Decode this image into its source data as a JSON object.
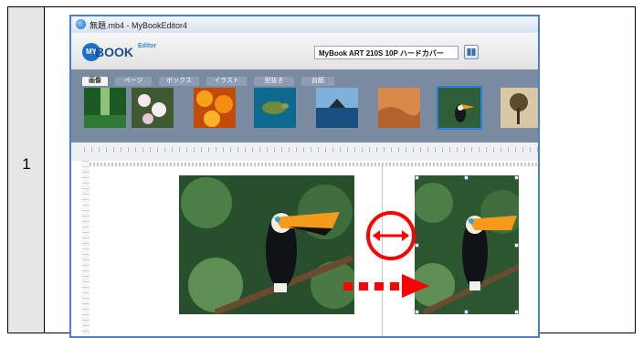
{
  "step": {
    "number": "1"
  },
  "window": {
    "title": "無題.mb4 - MyBookEditor4"
  },
  "toolbar": {
    "logo_badge": "MY",
    "logo_text": "BOOK",
    "logo_sub": "Editor",
    "product_select_value": "MyBook ART 210S 10P ハードカバー"
  },
  "tabs": [
    {
      "label": "画像",
      "active": true
    },
    {
      "label": "ページ",
      "active": false
    },
    {
      "label": "ボックス",
      "active": false
    },
    {
      "label": "イラスト",
      "active": false
    },
    {
      "label": "型抜き",
      "active": false
    },
    {
      "label": "台紙",
      "active": false
    }
  ],
  "thumbnails": [
    {
      "name": "forest-path-thumbnail",
      "selected": false
    },
    {
      "name": "white-flowers-thumbnail",
      "selected": false
    },
    {
      "name": "orange-flowers-thumbnail",
      "selected": false
    },
    {
      "name": "sea-turtle-thumbnail",
      "selected": false
    },
    {
      "name": "whale-tail-thumbnail",
      "selected": false
    },
    {
      "name": "desert-dunes-thumbnail",
      "selected": false
    },
    {
      "name": "toucan-thumbnail",
      "selected": true
    },
    {
      "name": "trees-thumbnail",
      "selected": false
    }
  ],
  "annotations": {
    "arrow_color": "#ff0000",
    "selection_color": "#2c7de0"
  },
  "colors": {
    "window_border": "#4a7fd0",
    "panel": "#7a8aa0",
    "brand": "#1d4f96"
  }
}
